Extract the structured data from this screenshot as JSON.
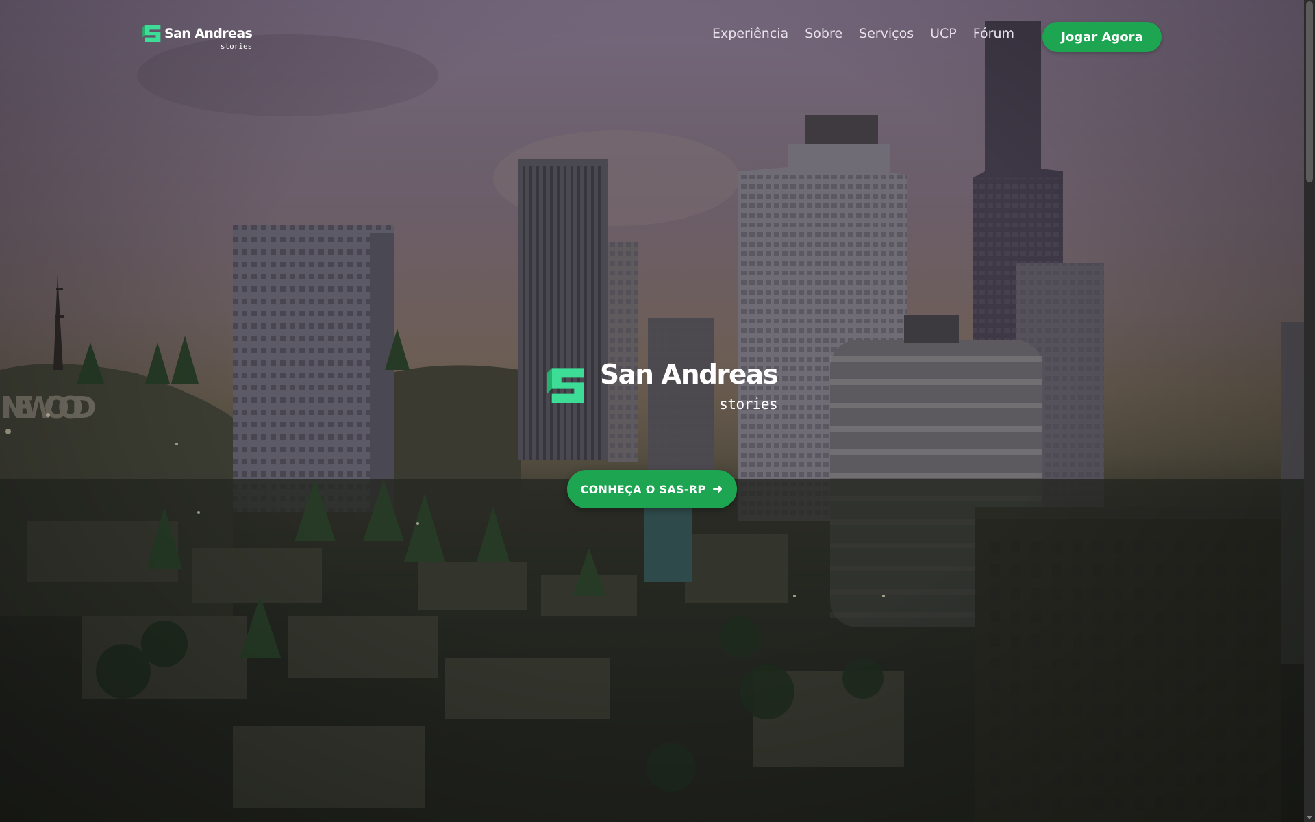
{
  "brand": {
    "name": "San Andreas",
    "tagline": "stories",
    "accent_color": "#1ea552",
    "logo_mark_color": "#3ddc97"
  },
  "nav": {
    "links": [
      "Experiência",
      "Sobre",
      "Serviços",
      "UCP",
      "Fórum"
    ],
    "play_button": "Jogar Agora"
  },
  "hero": {
    "cta_label": "CONHEÇA O SAS-RP",
    "cta_icon": "arrow-right-icon",
    "background": "city-skyline-photo",
    "sign_text": "INEWOOD"
  }
}
